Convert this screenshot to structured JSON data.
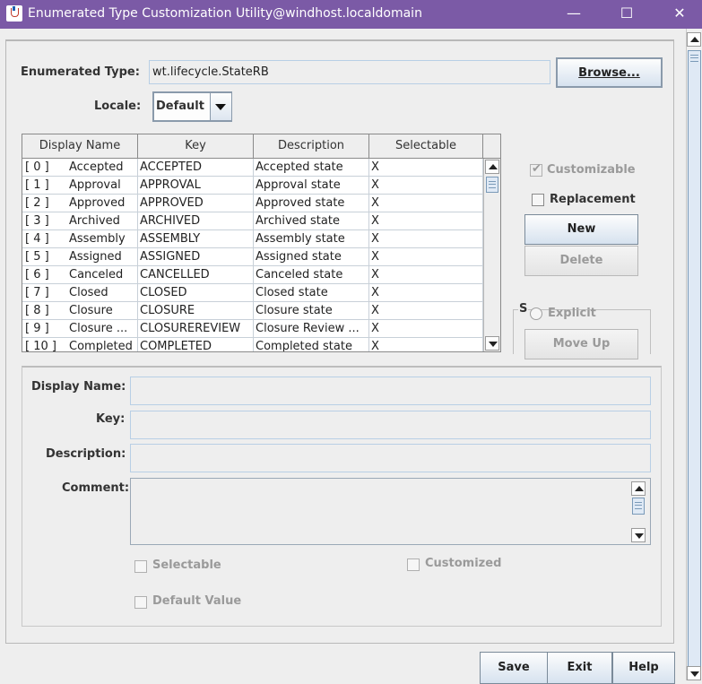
{
  "window": {
    "title": "Enumerated Type Customization Utility@windhost.localdomain",
    "minimize": "—",
    "maximize": "☐",
    "close": "✕"
  },
  "enum_type": {
    "label": "Enumerated Type:",
    "value": "wt.lifecycle.StateRB",
    "browse": "Browse..."
  },
  "locale": {
    "label": "Locale:",
    "value": "Default"
  },
  "table": {
    "columns": [
      "Display Name",
      "Key",
      "Description",
      "Selectable"
    ],
    "rows": [
      {
        "idx": "[ 0 ]",
        "name": "Accepted",
        "key": "ACCEPTED",
        "desc": "Accepted state",
        "sel": "X"
      },
      {
        "idx": "[ 1 ]",
        "name": "Approval",
        "key": "APPROVAL",
        "desc": "Approval state",
        "sel": "X"
      },
      {
        "idx": "[ 2 ]",
        "name": "Approved",
        "key": "APPROVED",
        "desc": "Approved state",
        "sel": "X"
      },
      {
        "idx": "[ 3 ]",
        "name": "Archived",
        "key": "ARCHIVED",
        "desc": "Archived state",
        "sel": "X"
      },
      {
        "idx": "[ 4 ]",
        "name": "Assembly",
        "key": "ASSEMBLY",
        "desc": "Assembly state",
        "sel": "X"
      },
      {
        "idx": "[ 5 ]",
        "name": "Assigned",
        "key": "ASSIGNED",
        "desc": "Assigned state",
        "sel": "X"
      },
      {
        "idx": "[ 6 ]",
        "name": "Canceled",
        "key": "CANCELLED",
        "desc": "Canceled state",
        "sel": "X"
      },
      {
        "idx": "[ 7 ]",
        "name": "Closed",
        "key": "CLOSED",
        "desc": "Closed state",
        "sel": "X"
      },
      {
        "idx": "[ 8 ]",
        "name": "Closure",
        "key": "CLOSURE",
        "desc": "Closure state",
        "sel": "X"
      },
      {
        "idx": "[ 9 ]",
        "name": "Closure ...",
        "key": "CLOSUREREVIEW",
        "desc": "Closure Review ...",
        "sel": "X"
      },
      {
        "idx": "[ 10 ]",
        "name": "Completed",
        "key": "COMPLETED",
        "desc": "Completed state",
        "sel": "X"
      }
    ]
  },
  "side": {
    "customizable": "Customizable",
    "replacement": "Replacement",
    "new": "New",
    "delete": "Delete",
    "group_letter": "S",
    "explicit": "Explicit",
    "move_up": "Move Up"
  },
  "details": {
    "display_name": "Display Name:",
    "key": "Key:",
    "description": "Description:",
    "comment": "Comment:",
    "selectable": "Selectable",
    "customized": "Customized",
    "default_value": "Default Value"
  },
  "footer": {
    "save": "Save",
    "exit": "Exit",
    "help": "Help"
  },
  "icons": {
    "app": "java-cup-icon",
    "dropdown": "triangle-down-icon",
    "check": "✔"
  }
}
